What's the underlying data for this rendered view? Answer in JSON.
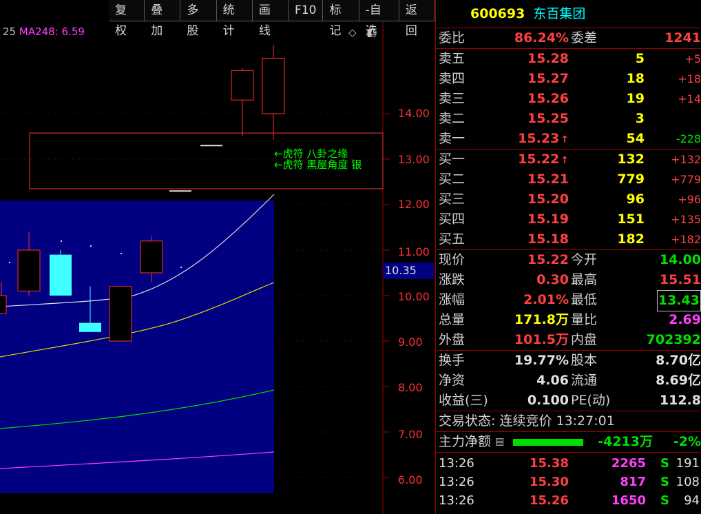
{
  "toolbar": {
    "buttons": [
      "复权",
      "叠加",
      "多股",
      "统计",
      "画线",
      "F10",
      "标记",
      "-自选",
      "返回"
    ]
  },
  "chart": {
    "ma_prefix": "25",
    "ma_label": "MA248: 6.59",
    "y_ticks": [
      "14.00",
      "13.00",
      "12.00",
      "11.00",
      "10.00",
      "9.00",
      "8.00",
      "7.00",
      "6.00"
    ],
    "price_tag": "10.35",
    "annotation_line1": "←虎符 八卦之缘",
    "annotation_line2": "←虎符 黑屋角度 银",
    "icons": [
      "diamond-icon",
      "window-icon"
    ],
    "candles": [
      {
        "open": 9.6,
        "close": 10.0,
        "high": 10.3,
        "low": 9.6,
        "color": "red"
      },
      {
        "open": 10.1,
        "close": 11.0,
        "high": 11.4,
        "low": 10.0,
        "color": "red"
      },
      {
        "open": 10.9,
        "close": 10.0,
        "high": 11.0,
        "low": 10.0,
        "color": "cyan"
      },
      {
        "open": 9.4,
        "close": 9.2,
        "high": 10.2,
        "low": 9.2,
        "color": "cyan"
      },
      {
        "open": 10.2,
        "close": 9.0,
        "high": 10.2,
        "low": 9.0,
        "color": "red"
      },
      {
        "open": 10.5,
        "close": 11.2,
        "high": 11.3,
        "low": 10.3,
        "color": "red"
      },
      {
        "open": 13.3,
        "close": 13.3,
        "high": 13.3,
        "low": 13.3,
        "color": "white"
      },
      {
        "open": 12.3,
        "close": 12.3,
        "high": 12.3,
        "low": 12.3,
        "color": "white"
      },
      {
        "open": 14.3,
        "close": 14.95,
        "high": 15.0,
        "low": 13.5,
        "color": "red"
      },
      {
        "open": 14.0,
        "close": 15.22,
        "high": 15.51,
        "low": 13.43,
        "color": "red"
      }
    ]
  },
  "quote": {
    "code": "600693",
    "name": "东百集团",
    "weibi_label": "委比",
    "weibi_value": "86.24%",
    "weicha_label": "委差",
    "weicha_value": "1241",
    "asks": [
      {
        "label": "卖五",
        "price": "15.28",
        "vol": "5",
        "chg": "+5"
      },
      {
        "label": "卖四",
        "price": "15.27",
        "vol": "18",
        "chg": "+18"
      },
      {
        "label": "卖三",
        "price": "15.26",
        "vol": "19",
        "chg": "+14"
      },
      {
        "label": "卖二",
        "price": "15.25",
        "vol": "3",
        "chg": ""
      },
      {
        "label": "卖一",
        "price": "15.23",
        "vol": "54",
        "chg": "-228"
      }
    ],
    "bids": [
      {
        "label": "买一",
        "price": "15.22",
        "vol": "132",
        "chg": "+132"
      },
      {
        "label": "买二",
        "price": "15.21",
        "vol": "779",
        "chg": "+779"
      },
      {
        "label": "买三",
        "price": "15.20",
        "vol": "96",
        "chg": "+96"
      },
      {
        "label": "买四",
        "price": "15.19",
        "vol": "151",
        "chg": "+135"
      },
      {
        "label": "买五",
        "price": "15.18",
        "vol": "182",
        "chg": "+182"
      }
    ],
    "stats1": [
      {
        "l1": "现价",
        "v1": "15.22",
        "l2": "今开",
        "v2": "14.00"
      },
      {
        "l1": "涨跌",
        "v1": "0.30",
        "l2": "最高",
        "v2": "15.51"
      },
      {
        "l1": "涨幅",
        "v1": "2.01%",
        "l2": "最低",
        "v2": "13.43"
      },
      {
        "l1": "总量",
        "v1": "171.8万",
        "l2": "量比",
        "v2": "2.69"
      },
      {
        "l1": "外盘",
        "v1": "101.5万",
        "l2": "内盘",
        "v2": "702392"
      }
    ],
    "stats2": [
      {
        "l1": "换手",
        "v1": "19.77%",
        "l2": "股本",
        "v2": "8.70亿"
      },
      {
        "l1": "净资",
        "v1": "4.06",
        "l2": "流通",
        "v2": "8.69亿"
      },
      {
        "l1": "收益(三)",
        "v1": "0.100",
        "l2": "PE(动)",
        "v2": "112.8"
      }
    ],
    "trade_status": "交易状态: 连续竞价 13:27:01",
    "flow_label": "主力净额",
    "flow_value": "-4213万",
    "flow_pct": "-2%",
    "ticks": [
      {
        "time": "13:26",
        "price": "15.38",
        "vol": "2265",
        "side": "S",
        "count": "191"
      },
      {
        "time": "13:26",
        "price": "15.30",
        "vol": "817",
        "side": "S",
        "count": "108"
      },
      {
        "time": "13:26",
        "price": "15.26",
        "vol": "1650",
        "side": "S",
        "count": "94"
      }
    ]
  },
  "colors": {
    "up": "#ff4040",
    "down": "#00e000",
    "accent": "#ffff00",
    "border": "#a00000"
  }
}
